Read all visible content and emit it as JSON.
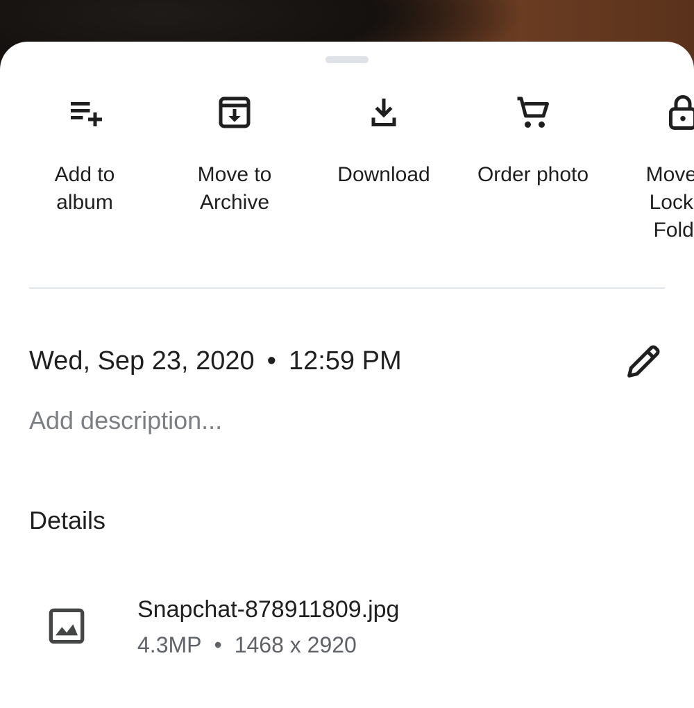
{
  "actions": [
    {
      "label": "Add to\nalbum",
      "icon": "playlist-add-icon"
    },
    {
      "label": "Move to\nArchive",
      "icon": "archive-icon"
    },
    {
      "label": "Download",
      "icon": "download-icon"
    },
    {
      "label": "Order photo",
      "icon": "cart-icon"
    },
    {
      "label": "Move to\nLocked\nFolder",
      "icon": "lock-icon"
    }
  ],
  "info": {
    "date": "Wed, Sep 23, 2020",
    "separator": "•",
    "time": "12:59 PM",
    "edit_icon": "pencil-icon"
  },
  "description": {
    "value": "",
    "placeholder": "Add description..."
  },
  "details": {
    "title": "Details",
    "file": {
      "icon": "image-icon",
      "name": "Snapchat-878911809.jpg",
      "megapixels": "4.3MP",
      "separator": "•",
      "resolution": "1468 x 2920"
    }
  },
  "colors": {
    "sheet_background": "#ffffff",
    "text_primary": "#1f1f1f",
    "text_secondary": "#5f6368",
    "divider": "#e2e6e9",
    "handle": "#dfe3e8"
  }
}
